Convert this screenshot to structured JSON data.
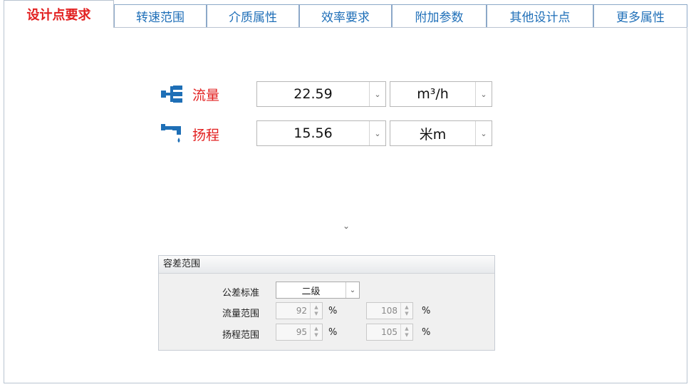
{
  "tabs": [
    {
      "label": "设计点要求",
      "active": true
    },
    {
      "label": "转速范围"
    },
    {
      "label": "介质属性"
    },
    {
      "label": "效率要求"
    },
    {
      "label": "附加参数"
    },
    {
      "label": "其他设计点"
    },
    {
      "label": "更多属性"
    }
  ],
  "design_point": {
    "flow": {
      "label": "流量",
      "value": "22.59",
      "unit": "m³/h",
      "icon": "flow-icon"
    },
    "head": {
      "label": "扬程",
      "value": "15.56",
      "unit": "米m",
      "icon": "head-icon"
    }
  },
  "tolerance": {
    "title": "容差范围",
    "standard_label": "公差标准",
    "standard_value": "二级",
    "flow_range_label": "流量范围",
    "flow_min": "92",
    "flow_max": "108",
    "head_range_label": "扬程范围",
    "head_min": "95",
    "head_max": "105",
    "percent": "%"
  },
  "colors": {
    "active_tab": "#e22020",
    "tab_text": "#1f6fb8",
    "icon": "#1e6fb6"
  }
}
